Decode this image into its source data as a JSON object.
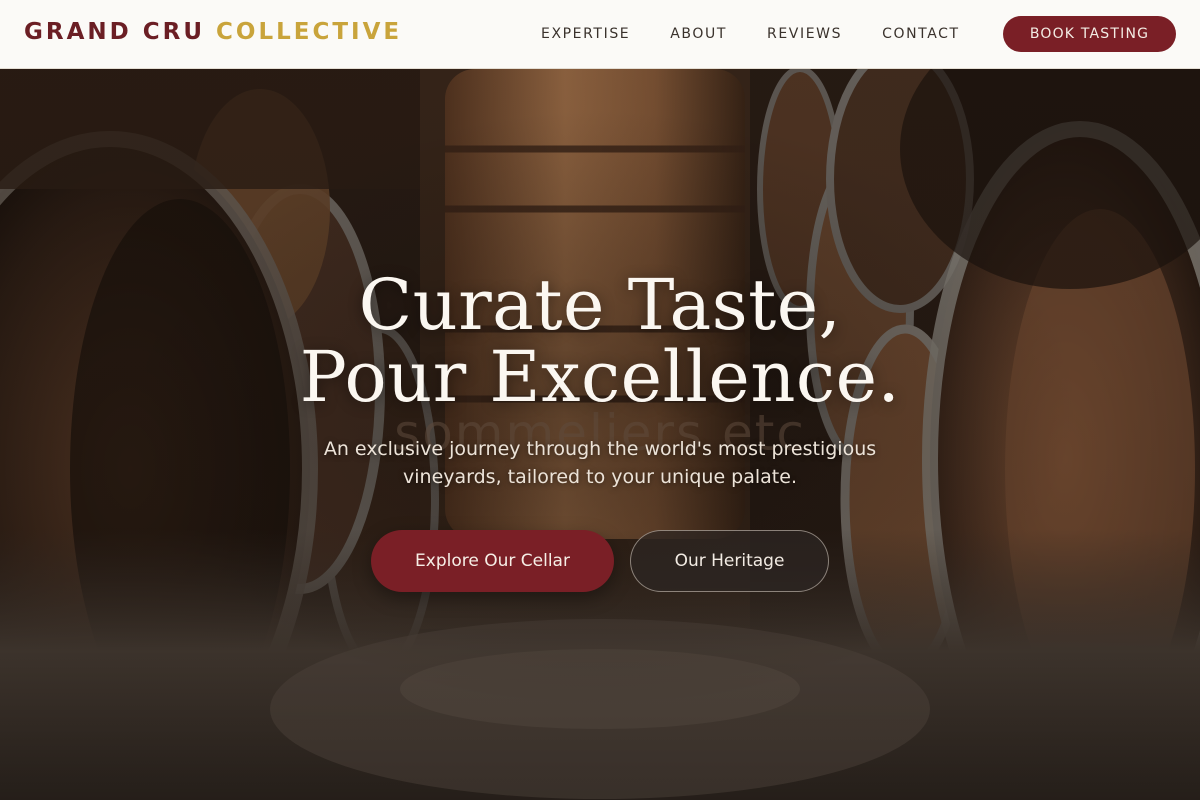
{
  "nav": {
    "brand": {
      "word1": "GRAND CRU",
      "word2": "COLLECTIVE"
    },
    "links": [
      {
        "label": "EXPERTISE"
      },
      {
        "label": "ABOUT"
      },
      {
        "label": "REVIEWS"
      },
      {
        "label": "CONTACT"
      }
    ],
    "cta": "BOOK TASTING"
  },
  "hero": {
    "headline_line1": "Curate Taste,",
    "headline_line2": "Pour Excellence.",
    "watermark": "sommeliers etc",
    "subtitle_line1": "An exclusive journey through the world's most prestigious",
    "subtitle_line2": "vineyards, tailored to your unique palate.",
    "primary_button": "Explore Our Cellar",
    "secondary_button": "Our Heritage",
    "background_image": "wine-cellar-barrels"
  },
  "colors": {
    "burgundy": "#7a1f26",
    "gold": "#c9a43b",
    "nav_background": "#fbfaf7",
    "nav_text": "#3a322c"
  }
}
